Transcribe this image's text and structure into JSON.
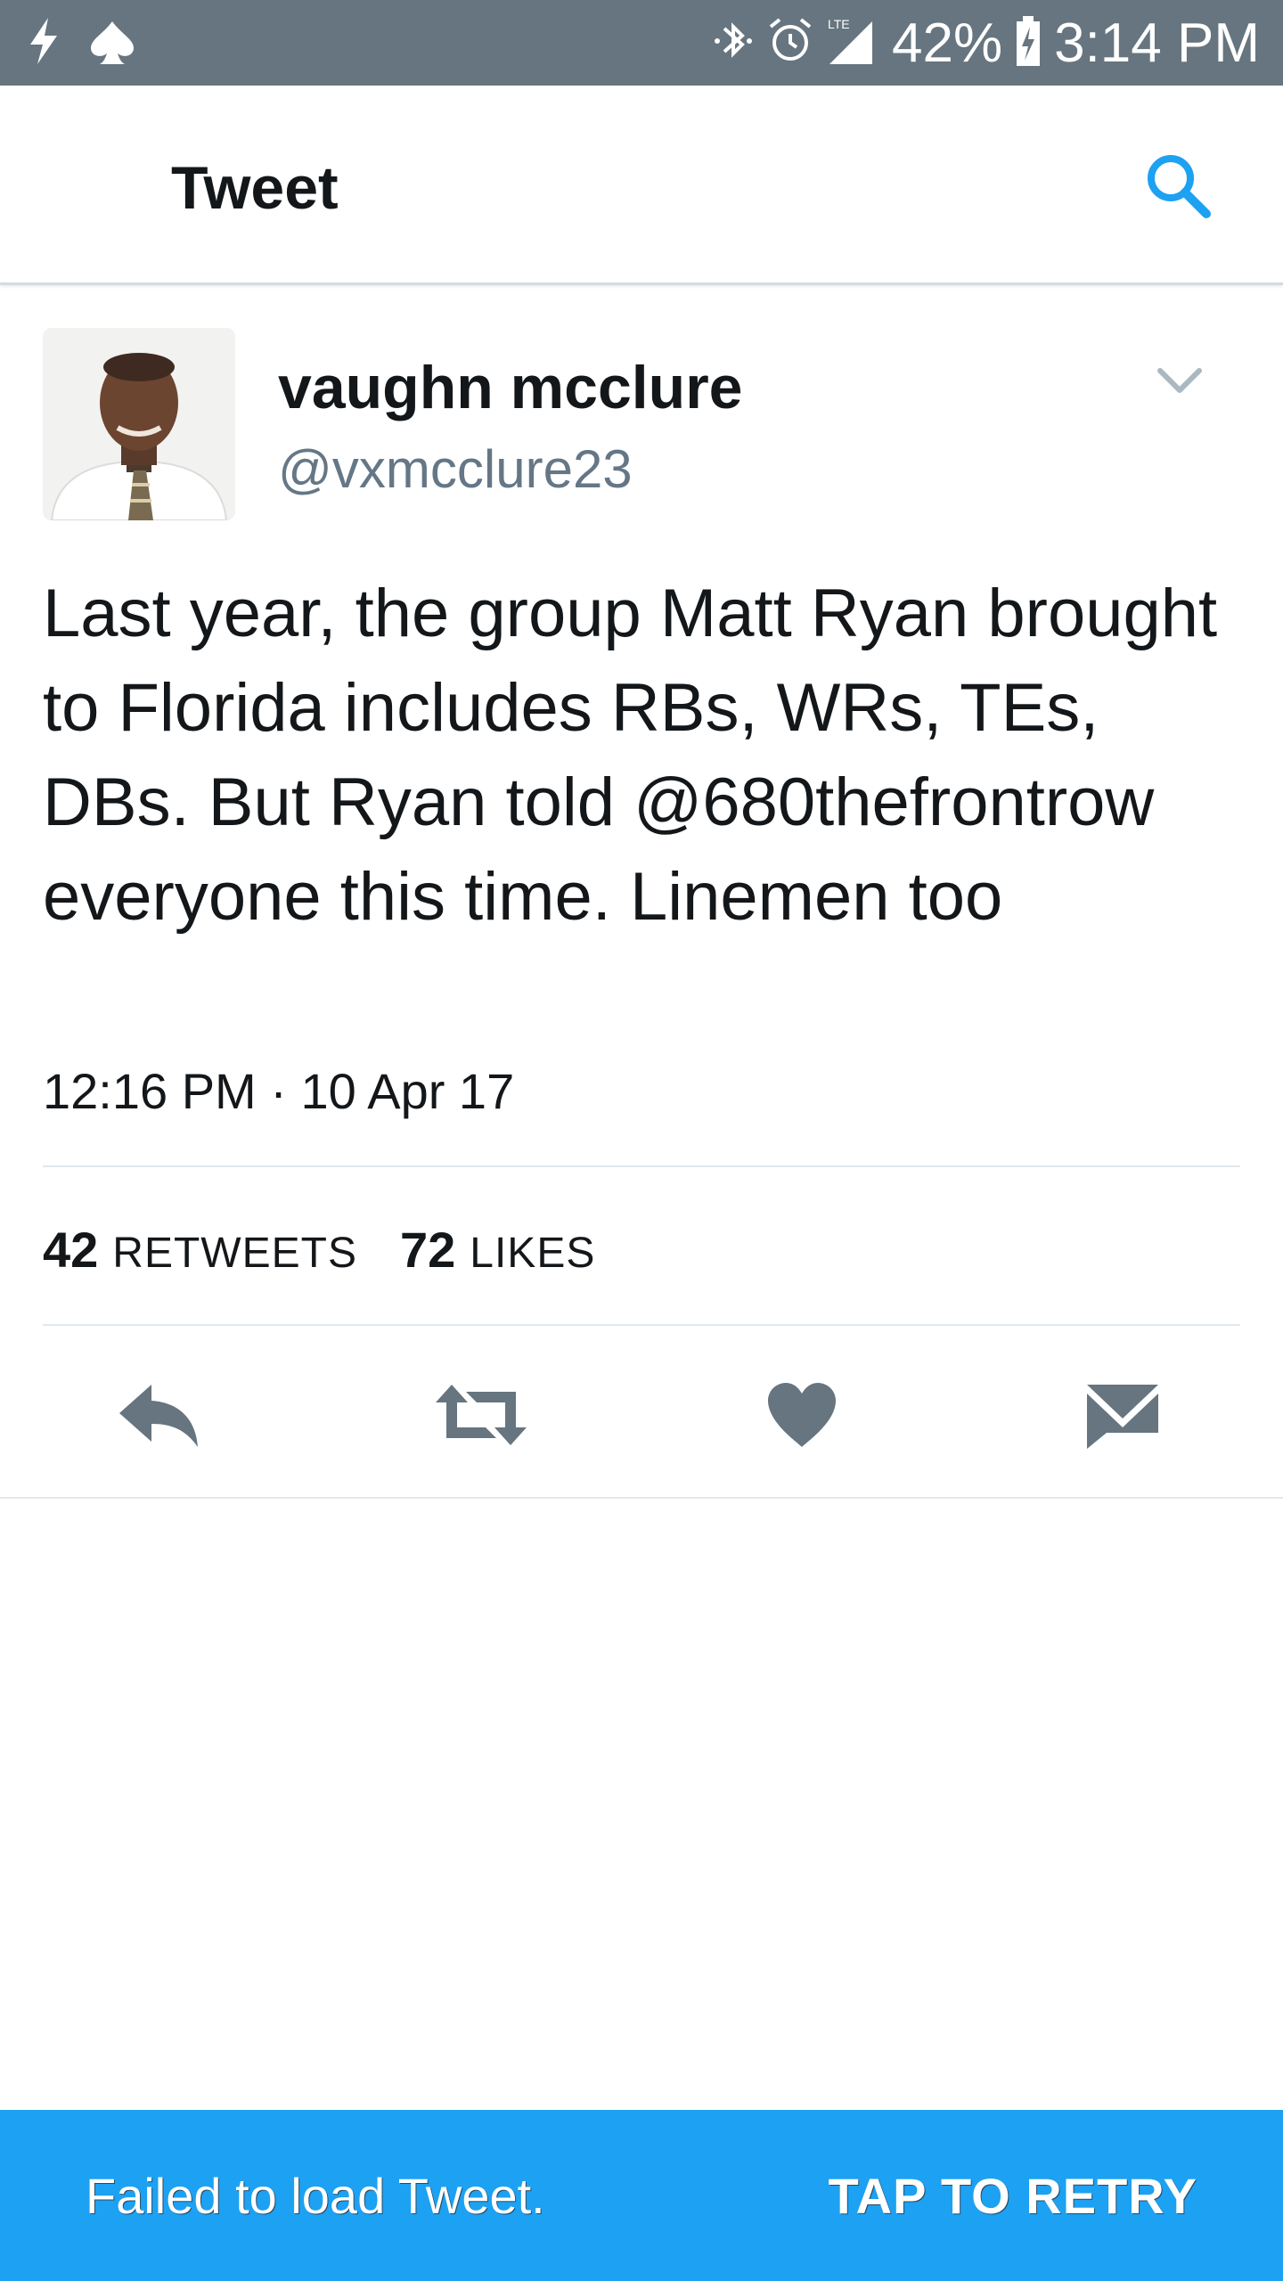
{
  "status_bar": {
    "battery": "42%",
    "time": "3:14 PM",
    "network": "LTE",
    "icons": [
      "flash-icon",
      "spade-icon",
      "bluetooth-icon",
      "alarm-icon",
      "signal-icon",
      "battery-charging-icon"
    ]
  },
  "app_bar": {
    "title": "Tweet",
    "search_icon": "search-icon"
  },
  "tweet": {
    "display_name": "vaughn mcclure",
    "handle": "@vxmcclure23",
    "text": "Last year, the group Matt Ryan brought to Florida includes RBs, WRs, TEs, DBs. But Ryan told @680thefrontrow everyone this time. Linemen too",
    "timestamp": "12:16 PM · 10 Apr 17",
    "retweets_count": "42",
    "retweets_label": "RETWEETS",
    "likes_count": "72",
    "likes_label": "LIKES"
  },
  "actions": [
    "reply-icon",
    "retweet-icon",
    "like-icon",
    "direct-message-icon"
  ],
  "snackbar": {
    "message": "Failed to load Tweet.",
    "action": "TAP TO RETRY"
  },
  "colors": {
    "status_bar": "#66757f",
    "accent": "#1da1f2",
    "icon_gray": "#66757f",
    "text": "#14171a",
    "secondary_text": "#657786"
  }
}
